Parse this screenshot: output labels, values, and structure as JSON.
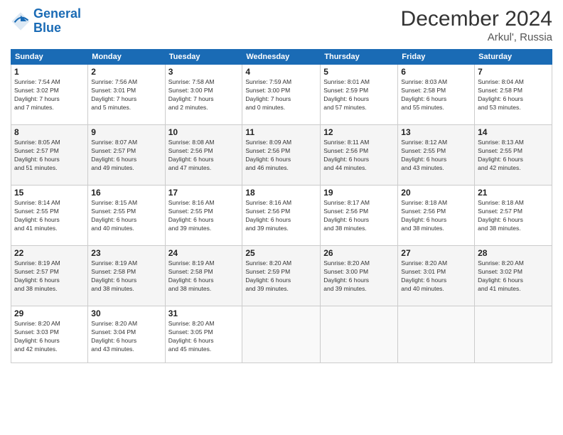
{
  "header": {
    "logo_line1": "General",
    "logo_line2": "Blue",
    "title": "December 2024",
    "subtitle": "Arkul', Russia"
  },
  "days_of_week": [
    "Sunday",
    "Monday",
    "Tuesday",
    "Wednesday",
    "Thursday",
    "Friday",
    "Saturday"
  ],
  "weeks": [
    [
      {
        "num": "1",
        "info": "Sunrise: 7:54 AM\nSunset: 3:02 PM\nDaylight: 7 hours\nand 7 minutes."
      },
      {
        "num": "2",
        "info": "Sunrise: 7:56 AM\nSunset: 3:01 PM\nDaylight: 7 hours\nand 5 minutes."
      },
      {
        "num": "3",
        "info": "Sunrise: 7:58 AM\nSunset: 3:00 PM\nDaylight: 7 hours\nand 2 minutes."
      },
      {
        "num": "4",
        "info": "Sunrise: 7:59 AM\nSunset: 3:00 PM\nDaylight: 7 hours\nand 0 minutes."
      },
      {
        "num": "5",
        "info": "Sunrise: 8:01 AM\nSunset: 2:59 PM\nDaylight: 6 hours\nand 57 minutes."
      },
      {
        "num": "6",
        "info": "Sunrise: 8:03 AM\nSunset: 2:58 PM\nDaylight: 6 hours\nand 55 minutes."
      },
      {
        "num": "7",
        "info": "Sunrise: 8:04 AM\nSunset: 2:58 PM\nDaylight: 6 hours\nand 53 minutes."
      }
    ],
    [
      {
        "num": "8",
        "info": "Sunrise: 8:05 AM\nSunset: 2:57 PM\nDaylight: 6 hours\nand 51 minutes."
      },
      {
        "num": "9",
        "info": "Sunrise: 8:07 AM\nSunset: 2:57 PM\nDaylight: 6 hours\nand 49 minutes."
      },
      {
        "num": "10",
        "info": "Sunrise: 8:08 AM\nSunset: 2:56 PM\nDaylight: 6 hours\nand 47 minutes."
      },
      {
        "num": "11",
        "info": "Sunrise: 8:09 AM\nSunset: 2:56 PM\nDaylight: 6 hours\nand 46 minutes."
      },
      {
        "num": "12",
        "info": "Sunrise: 8:11 AM\nSunset: 2:56 PM\nDaylight: 6 hours\nand 44 minutes."
      },
      {
        "num": "13",
        "info": "Sunrise: 8:12 AM\nSunset: 2:55 PM\nDaylight: 6 hours\nand 43 minutes."
      },
      {
        "num": "14",
        "info": "Sunrise: 8:13 AM\nSunset: 2:55 PM\nDaylight: 6 hours\nand 42 minutes."
      }
    ],
    [
      {
        "num": "15",
        "info": "Sunrise: 8:14 AM\nSunset: 2:55 PM\nDaylight: 6 hours\nand 41 minutes."
      },
      {
        "num": "16",
        "info": "Sunrise: 8:15 AM\nSunset: 2:55 PM\nDaylight: 6 hours\nand 40 minutes."
      },
      {
        "num": "17",
        "info": "Sunrise: 8:16 AM\nSunset: 2:55 PM\nDaylight: 6 hours\nand 39 minutes."
      },
      {
        "num": "18",
        "info": "Sunrise: 8:16 AM\nSunset: 2:56 PM\nDaylight: 6 hours\nand 39 minutes."
      },
      {
        "num": "19",
        "info": "Sunrise: 8:17 AM\nSunset: 2:56 PM\nDaylight: 6 hours\nand 38 minutes."
      },
      {
        "num": "20",
        "info": "Sunrise: 8:18 AM\nSunset: 2:56 PM\nDaylight: 6 hours\nand 38 minutes."
      },
      {
        "num": "21",
        "info": "Sunrise: 8:18 AM\nSunset: 2:57 PM\nDaylight: 6 hours\nand 38 minutes."
      }
    ],
    [
      {
        "num": "22",
        "info": "Sunrise: 8:19 AM\nSunset: 2:57 PM\nDaylight: 6 hours\nand 38 minutes."
      },
      {
        "num": "23",
        "info": "Sunrise: 8:19 AM\nSunset: 2:58 PM\nDaylight: 6 hours\nand 38 minutes."
      },
      {
        "num": "24",
        "info": "Sunrise: 8:19 AM\nSunset: 2:58 PM\nDaylight: 6 hours\nand 38 minutes."
      },
      {
        "num": "25",
        "info": "Sunrise: 8:20 AM\nSunset: 2:59 PM\nDaylight: 6 hours\nand 39 minutes."
      },
      {
        "num": "26",
        "info": "Sunrise: 8:20 AM\nSunset: 3:00 PM\nDaylight: 6 hours\nand 39 minutes."
      },
      {
        "num": "27",
        "info": "Sunrise: 8:20 AM\nSunset: 3:01 PM\nDaylight: 6 hours\nand 40 minutes."
      },
      {
        "num": "28",
        "info": "Sunrise: 8:20 AM\nSunset: 3:02 PM\nDaylight: 6 hours\nand 41 minutes."
      }
    ],
    [
      {
        "num": "29",
        "info": "Sunrise: 8:20 AM\nSunset: 3:03 PM\nDaylight: 6 hours\nand 42 minutes."
      },
      {
        "num": "30",
        "info": "Sunrise: 8:20 AM\nSunset: 3:04 PM\nDaylight: 6 hours\nand 43 minutes."
      },
      {
        "num": "31",
        "info": "Sunrise: 8:20 AM\nSunset: 3:05 PM\nDaylight: 6 hours\nand 45 minutes."
      },
      {
        "num": "",
        "info": ""
      },
      {
        "num": "",
        "info": ""
      },
      {
        "num": "",
        "info": ""
      },
      {
        "num": "",
        "info": ""
      }
    ]
  ]
}
